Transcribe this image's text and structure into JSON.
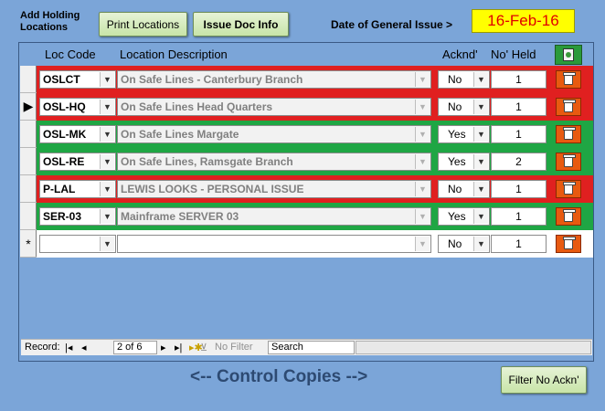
{
  "header": {
    "title": "Add Holding Locations",
    "print_label": "Print Locations",
    "issue_label": "Issue Doc Info",
    "date_label": "Date of General Issue  >",
    "date_value": "16-Feb-16"
  },
  "columns": {
    "loc_code": "Loc Code",
    "location_description": "Location Description",
    "acknd": "Acknd'",
    "no_held": "No' Held"
  },
  "rows": [
    {
      "code": "OSLCT",
      "desc": "On Safe Lines - Canterbury Branch",
      "ack": "No",
      "held": "1",
      "status": "red"
    },
    {
      "code": "OSL-HQ",
      "desc": "On Safe Lines Head Quarters",
      "ack": "No",
      "held": "1",
      "status": "red"
    },
    {
      "code": "OSL-MK",
      "desc": "On Safe Lines Margate",
      "ack": "Yes",
      "held": "1",
      "status": "green"
    },
    {
      "code": "OSL-RE",
      "desc": "On Safe Lines, Ramsgate Branch",
      "ack": "Yes",
      "held": "2",
      "status": "green"
    },
    {
      "code": "P-LAL",
      "desc": "LEWIS LOOKS - PERSONAL ISSUE",
      "ack": "No",
      "held": "1",
      "status": "red"
    },
    {
      "code": "SER-03",
      "desc": "Mainframe SERVER 03",
      "ack": "Yes",
      "held": "1",
      "status": "green"
    },
    {
      "code": "",
      "desc": "",
      "ack": "No",
      "held": "1",
      "status": "new"
    }
  ],
  "selectors": [
    "",
    "▶",
    "",
    "",
    "",
    "",
    "*"
  ],
  "navigation": {
    "record_label": "Record:",
    "current": "2 of 6",
    "filter_label": "No Filter",
    "search_label": "Search"
  },
  "footer": {
    "control_copies": "<-- Control Copies -->",
    "filter_button": "Filter No Ackn'"
  },
  "colors": {
    "background": "#7ba5d8",
    "red_row": "#e02020",
    "green_row": "#1fa644",
    "date_bg": "#ffff00",
    "date_text": "#e00000",
    "delete_button": "#e85a10"
  },
  "icons": {
    "delete": "trash-icon",
    "header": "document-icon",
    "dropdown": "chevron-down-icon"
  }
}
